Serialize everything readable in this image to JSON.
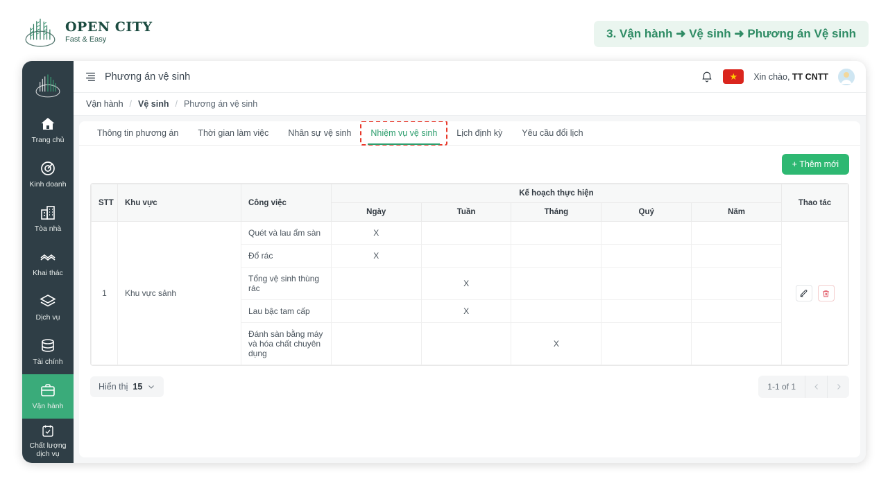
{
  "brand": {
    "title": "OPEN CITY",
    "tagline": "Fast & Easy",
    "logo_icon": "city-skyline-logo"
  },
  "topic_banner": {
    "text": "3. Vận hành ➜ Vệ sinh ➜ Phương án Vệ sinh",
    "color": "#2e8b64",
    "background": "#eaf5ef"
  },
  "sidebar": {
    "logo_icon": "city-skyline-logo",
    "active_index": 6,
    "items": [
      {
        "label": "Trang chủ",
        "icon": "home-icon"
      },
      {
        "label": "Kinh doanh",
        "icon": "target-icon"
      },
      {
        "label": "Tòa nhà",
        "icon": "building-icon"
      },
      {
        "label": "Khai thác",
        "icon": "handshake-icon"
      },
      {
        "label": "Dịch vụ",
        "icon": "layers-icon"
      },
      {
        "label": "Tài chính",
        "icon": "database-icon"
      },
      {
        "label": "Vận hành",
        "icon": "briefcase-icon"
      },
      {
        "label": "Chất lượng dịch vụ",
        "icon": "calendar-check-icon"
      }
    ]
  },
  "topbar": {
    "menu_icon": "menu-fold-icon",
    "title": "Phương án vệ sinh",
    "bell_icon": "bell-icon",
    "language_flag": "vietnam-flag-icon",
    "greeting_prefix": "Xin chào,",
    "user_name": "TT CNTT",
    "avatar_icon": "user-avatar"
  },
  "breadcrumb": {
    "items": [
      "Vận hành",
      "Vệ sinh",
      "Phương án vệ sinh"
    ],
    "separator": "/"
  },
  "tabs": {
    "active_index": 3,
    "marked_index": 3,
    "items": [
      {
        "label": "Thông tin phương án"
      },
      {
        "label": "Thời gian làm việc"
      },
      {
        "label": "Nhân sự vệ sinh"
      },
      {
        "label": "Nhiệm vụ vệ sinh"
      },
      {
        "label": "Lịch định kỳ"
      },
      {
        "label": "Yêu cầu đổi lịch"
      }
    ]
  },
  "toolbar": {
    "add_label": "+ Thêm mới",
    "add_color": "#2eb872"
  },
  "table": {
    "headers": {
      "stt": "STT",
      "area": "Khu vực",
      "job": "Công việc",
      "plan_group": "Kế hoạch thực hiện",
      "plan_cols": [
        "Ngày",
        "Tuần",
        "Tháng",
        "Quý",
        "Năm"
      ],
      "action": "Thao tác"
    },
    "mark": "X",
    "rows": [
      {
        "stt": "1",
        "area": "Khu vực sảnh",
        "tasks": [
          {
            "job": "Quét và lau ẩm sàn",
            "plan": [
              "X",
              "",
              "",
              "",
              ""
            ]
          },
          {
            "job": "Đổ rác",
            "plan": [
              "X",
              "",
              "",
              "",
              ""
            ]
          },
          {
            "job": "Tổng vệ sinh thùng rác",
            "plan": [
              "",
              "X",
              "",
              "",
              ""
            ]
          },
          {
            "job": "Lau bậc tam cấp",
            "plan": [
              "",
              "X",
              "",
              "",
              ""
            ]
          },
          {
            "job": "Đánh sàn bằng máy và hóa chất chuyên dụng",
            "plan": [
              "",
              "",
              "X",
              "",
              ""
            ]
          }
        ],
        "actions": {
          "edit_icon": "edit-icon",
          "delete_icon": "trash-icon"
        }
      }
    ]
  },
  "footer": {
    "show_label": "Hiển thị",
    "show_value": "15",
    "chevron_icon": "chevron-down-icon",
    "range_text": "1-1 of 1",
    "prev_icon": "chevron-left-icon",
    "next_icon": "chevron-right-icon"
  }
}
